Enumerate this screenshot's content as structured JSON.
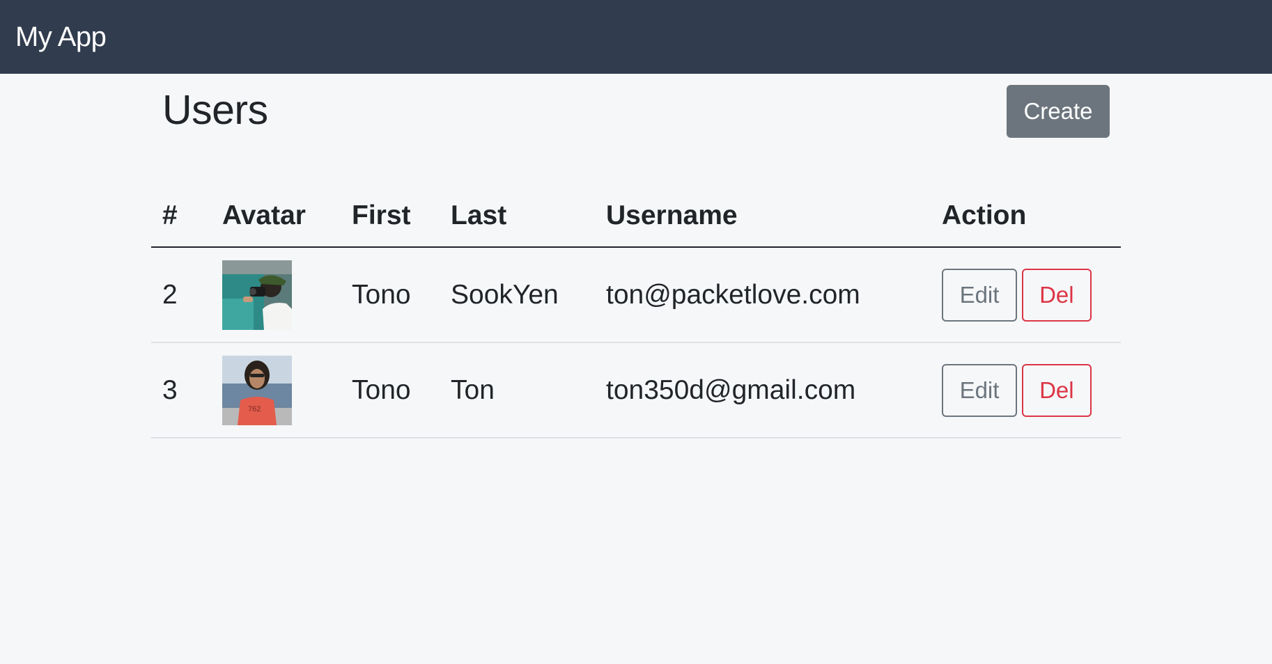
{
  "navbar": {
    "brand": "My App"
  },
  "page": {
    "title": "Users",
    "create_label": "Create"
  },
  "table": {
    "headers": [
      "#",
      "Avatar",
      "First",
      "Last",
      "Username",
      "Action"
    ],
    "rows": [
      {
        "id": "2",
        "first": "Tono",
        "last": "SookYen",
        "username": "ton@packetlove.com",
        "edit_label": "Edit",
        "del_label": "Del"
      },
      {
        "id": "3",
        "first": "Tono",
        "last": "Ton",
        "username": "ton350d@gmail.com",
        "edit_label": "Edit",
        "del_label": "Del"
      }
    ]
  },
  "colors": {
    "navbar_bg": "#313c4e",
    "secondary": "#6c757d",
    "danger": "#dc3545"
  }
}
